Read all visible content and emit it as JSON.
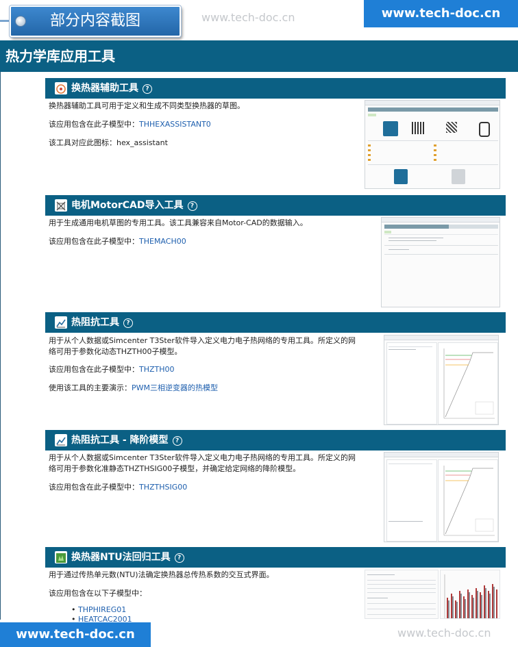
{
  "banner": {
    "tag_label": "部分内容截图",
    "watermark": "www.tech-doc.cn",
    "site": "www.tech-doc.cn"
  },
  "header": {
    "title": "热力学库应用工具"
  },
  "sections": [
    {
      "title": "换热器辅助工具",
      "icon": "heat-exchanger-icon",
      "lines": [
        {
          "text": "换热器辅助工具可用于定义和生成不同类型换热器的草图。"
        },
        {
          "text": "该应用包含在此子模型中：",
          "link": "THHEXASSISTANT0"
        },
        {
          "text": "该工具对应此图标：hex_assistant"
        }
      ]
    },
    {
      "title": "电机MotorCAD导入工具",
      "icon": "motor-icon",
      "lines": [
        {
          "text": "用于生成通用电机草图的专用工具。该工具兼容来自Motor-CAD的数据输入。"
        },
        {
          "text": "该应用包含在此子模型中：",
          "link": "THEMACH00"
        }
      ]
    },
    {
      "title": "热阻抗工具",
      "icon": "impedance-icon",
      "lines": [
        {
          "text": "用于从个人数据或Simcenter T3Ster软件导入定义电力电子热网络的专用工具。所定义的网"
        },
        {
          "text": "络可用于参数化动态THZTH00子模型。"
        },
        {
          "text": "该应用包含在此子模型中：",
          "link": "THZTH00"
        },
        {
          "text": "使用该工具的主要演示：",
          "link": "PWM三相逆变器的热模型"
        }
      ]
    },
    {
      "title": "热阻抗工具 - 降阶模型",
      "icon": "impedance-rom-icon",
      "lines": [
        {
          "text": "用于从个人数据或Simcenter T3Ster软件导入定义电力电子热网络的专用工具。所定义的网"
        },
        {
          "text": "络可用于参数化准静态THZTHSIG00子模型，并确定给定网络的降阶模型。"
        },
        {
          "text": "该应用包含在此子模型中：",
          "link": "THZTHSIG00"
        }
      ]
    },
    {
      "title": "换热器NTU法回归工具",
      "icon": "ntu-regression-icon",
      "lines": [
        {
          "text": "用于通过传热单元数(NTU)法确定换热器总传热系数的交互式界面。"
        },
        {
          "text": "该应用包含在以下子模型中："
        }
      ],
      "bullets": [
        "THPHIREG01",
        "HEATCAC2001"
      ]
    }
  ],
  "footer": {
    "site": "www.tech-doc.cn",
    "watermark": "www.tech-doc.cn"
  },
  "colors": {
    "section_bar": "#0b6084",
    "accent_blue": "#1f7fd6",
    "link": "#1e5fae"
  }
}
